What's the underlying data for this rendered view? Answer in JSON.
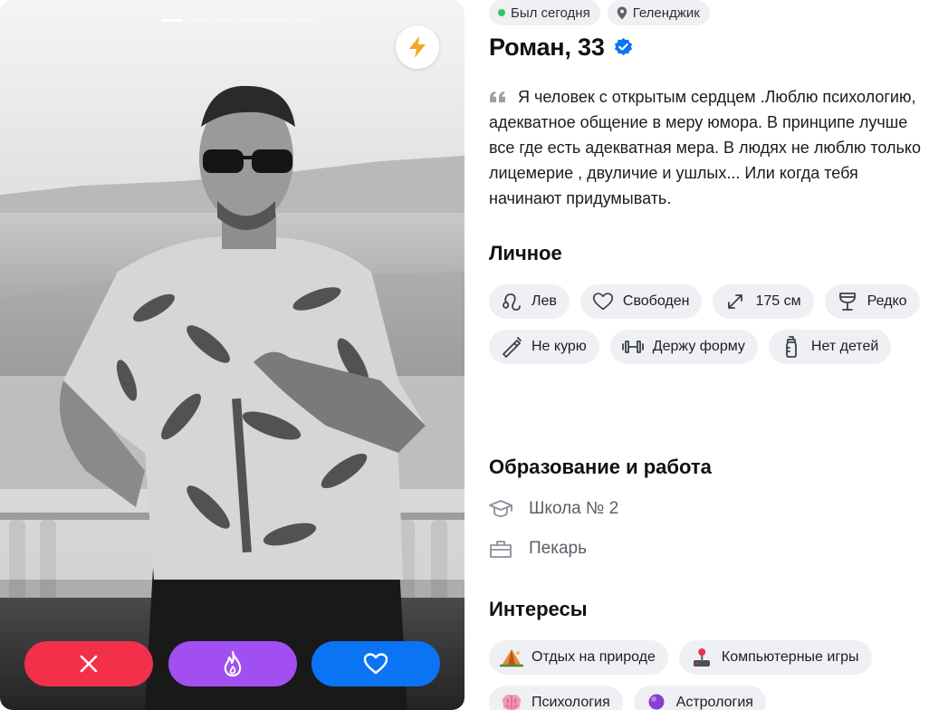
{
  "profile": {
    "status": "Был сегодня",
    "city": "Геленджик",
    "name_age": "Роман, 33",
    "bio": "Я человек с открытым сердцем .Люблю психологию, адекватное общение в меру юмора. В принципе лучше все где есть адекватная мера. В людях не люблю только лицемерие , двуличие и ушлых... Или когда тебя начинают придумывать."
  },
  "photo": {
    "count": 6,
    "active_index": 0
  },
  "colors": {
    "dislike": "#f2304a",
    "superlike": "#a14ff0",
    "like": "#0a74f5",
    "verified": "#0a74f5",
    "online": "#2fc76a",
    "boost": "#f5a623"
  },
  "sections": {
    "personal": {
      "title": "Личное",
      "chips": [
        {
          "icon": "leo-icon",
          "label": "Лев"
        },
        {
          "icon": "heart-outline-icon",
          "label": "Свободен"
        },
        {
          "icon": "height-icon",
          "label": "175 см"
        },
        {
          "icon": "wine-glass-icon",
          "label": "Редко"
        },
        {
          "icon": "no-smoking-icon",
          "label": "Не курю"
        },
        {
          "icon": "dumbbell-icon",
          "label": "Держу форму"
        },
        {
          "icon": "baby-bottle-icon",
          "label": "Нет детей"
        }
      ]
    },
    "education": {
      "title": "Образование и работа",
      "school": "Школа № 2",
      "job": "Пекарь"
    },
    "interests": {
      "title": "Интересы",
      "chips": [
        {
          "icon": "tent-icon",
          "label": "Отдых на природе"
        },
        {
          "icon": "joystick-icon",
          "label": "Компьютерные игры"
        },
        {
          "icon": "brain-icon",
          "label": "Психология"
        },
        {
          "icon": "crystal-ball-icon",
          "label": "Астрология"
        }
      ]
    }
  }
}
